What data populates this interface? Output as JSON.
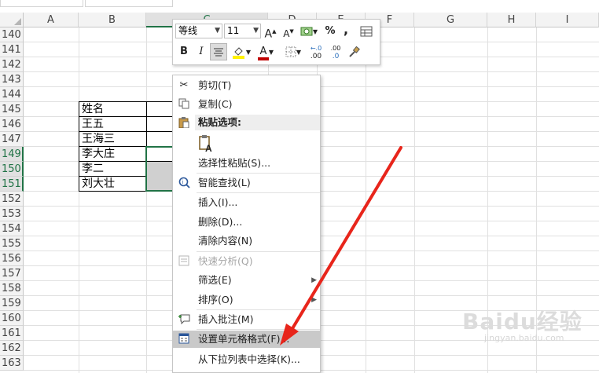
{
  "sheet": {
    "columns": [
      "A",
      "B",
      "C",
      "D",
      "E",
      "F",
      "G",
      "H",
      "I"
    ],
    "rows": [
      "140",
      "141",
      "142",
      "143",
      "144",
      "145",
      "146",
      "147",
      "148",
      "149",
      "150",
      "151",
      "152",
      "153",
      "154",
      "155",
      "156",
      "157",
      "158",
      "159",
      "160",
      "161",
      "162",
      "163"
    ],
    "cells": {
      "b145": "姓名",
      "b146": "王五",
      "b147": "王海三",
      "b148": "李大庄",
      "b150": "李二",
      "b151": "刘大壮"
    }
  },
  "mini_toolbar": {
    "font_name": "等线",
    "font_size": "11",
    "grow_font": "A",
    "shrink_font": "A",
    "percent": "%",
    "comma": ",",
    "bold": "B",
    "italic": "I",
    "font_color": "A",
    "inc_decimal": ".00",
    "dec_decimal": ".0",
    "accent_color": "#C00000",
    "fill_color": "#FFF200"
  },
  "context_menu": {
    "cut": "剪切(T)",
    "copy": "复制(C)",
    "paste_options": "粘贴选项:",
    "paste_special": "选择性粘贴(S)...",
    "smart_lookup": "智能查找(L)",
    "insert": "插入(I)...",
    "delete": "删除(D)...",
    "clear": "清除内容(N)",
    "quick_analysis": "快速分析(Q)",
    "filter": "筛选(E)",
    "sort": "排序(O)",
    "insert_comment": "插入批注(M)",
    "format_cells": "设置单元格格式(F)...",
    "pick_from_list": "从下拉列表中选择(K)..."
  },
  "watermark": {
    "text": "Baidu经验",
    "sub": "jingyan.baidu.com"
  },
  "arrow_color": "#E8251B"
}
